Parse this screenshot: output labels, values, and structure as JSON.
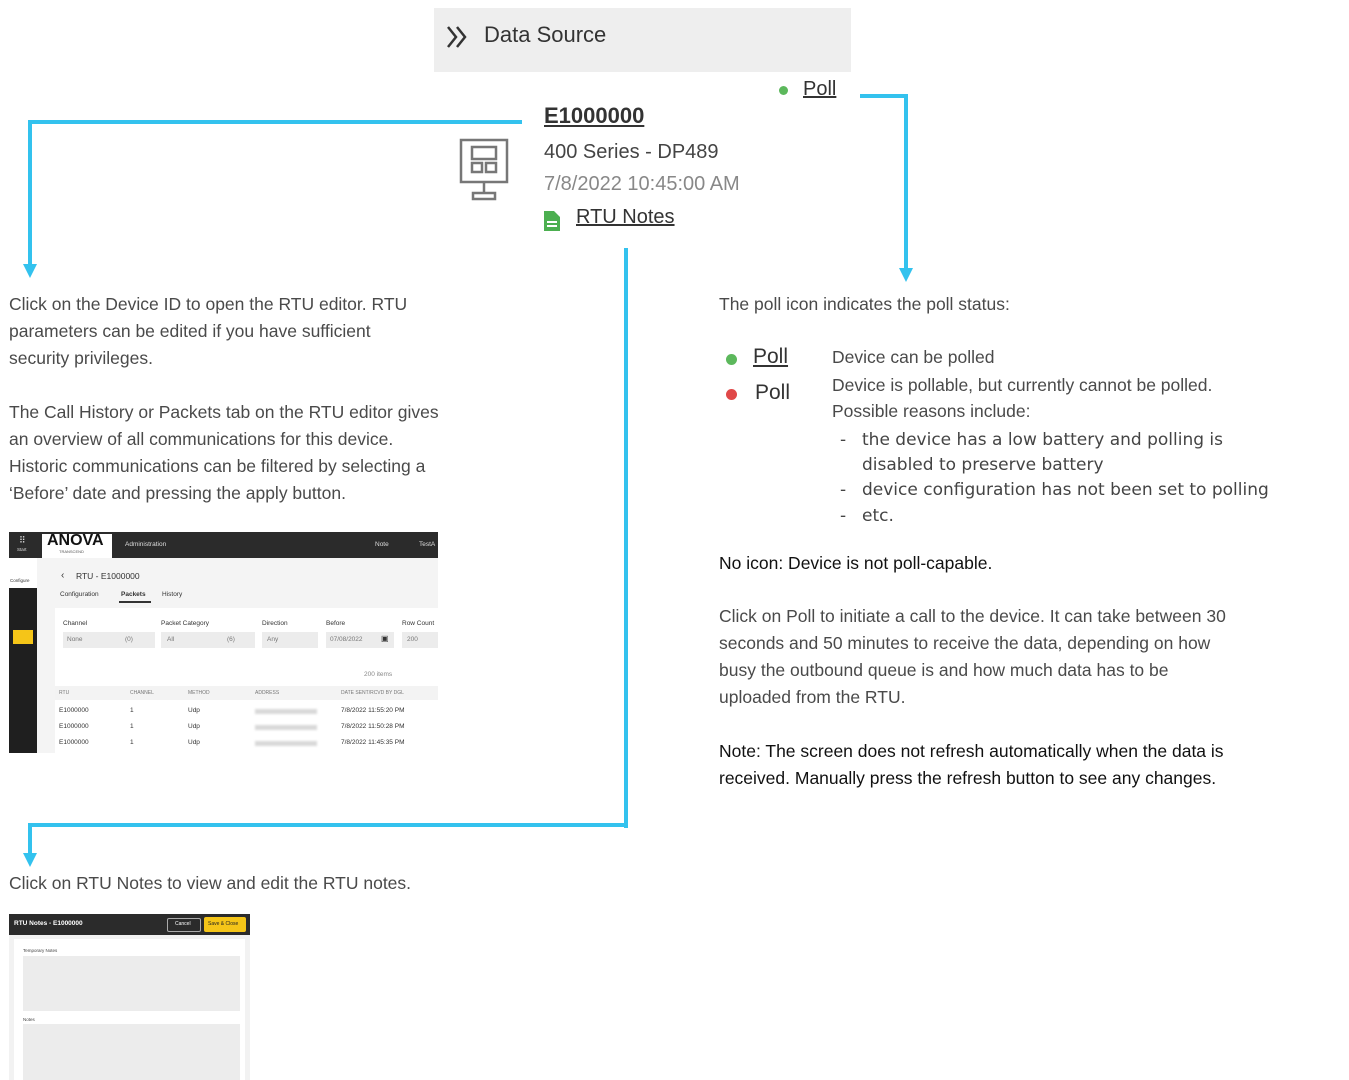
{
  "header": {
    "title": "Data Source",
    "chevron_icon": "double-chevron-right-icon"
  },
  "device": {
    "id": "E1000000",
    "series": "400 Series - DP489",
    "datetime": "7/8/2022 10:45:00 AM",
    "notes_link": "RTU Notes",
    "poll_link": "Poll",
    "poll_color": "#5cb85c"
  },
  "left_text": {
    "p1": [
      "Click on the Device ID to open the RTU editor. RTU",
      "parameters can be edited if you have sufficient",
      "security privileges."
    ],
    "p2": [
      "The Call History or Packets tab on the RTU editor gives",
      "an overview of all communications for this device.",
      "Historic communications can be filtered by selecting a",
      "‘Before’ date and pressing the apply button."
    ],
    "notes_text": "Click on RTU Notes to view and edit the RTU notes."
  },
  "right_text": {
    "intro": "The poll icon indicates the poll status:",
    "legend": [
      {
        "label": "Poll",
        "color": "#5cb85c",
        "desc": "Device can be polled"
      },
      {
        "label": "Poll",
        "color": "#e04848",
        "desc": "Device is pollable, but currently cannot be polled."
      }
    ],
    "reasons_intro": "Possible reasons include:",
    "reasons": [
      "the device has a low battery and polling is",
      "disabled to preserve battery",
      "device configuration has not been set to polling",
      "etc."
    ],
    "no_icon": "No icon: Device is not poll-capable.",
    "click_poll": [
      "Click on Poll to initiate a call to the device. It can take between 30",
      "seconds and 50 minutes to receive the data, depending on how",
      "busy the outbound queue is and how much data has to be",
      "uploaded from the RTU."
    ],
    "note": [
      "Note: The screen does not refresh automatically when the data is",
      "received. Manually press the refresh button to see any changes."
    ]
  },
  "rtu_editor": {
    "brand": "ANOVA",
    "brand_sub": "TRANSCEND",
    "nav": "Administration",
    "start": "Start",
    "configure": "Configure",
    "note": "Note",
    "user": "TestA",
    "title": "RTU - E1000000",
    "tabs": [
      "Configuration",
      "Packets",
      "History"
    ],
    "active_tab": "Packets",
    "filters": [
      {
        "label": "Channel",
        "value": "None",
        "count": "(0)"
      },
      {
        "label": "Packet Category",
        "value": "All",
        "count": "(6)"
      },
      {
        "label": "Direction",
        "value": "Any",
        "count": ""
      },
      {
        "label": "Before",
        "value": "07/08/2022",
        "count": ""
      },
      {
        "label": "Row Count",
        "value": "200",
        "count": ""
      }
    ],
    "items_count": "200 items",
    "columns": [
      "RTU",
      "CHANNEL",
      "METHOD",
      "ADDRESS",
      "DATE SENT/RCVD BY DGL"
    ],
    "rows": [
      [
        "E1000000",
        "1",
        "Udp",
        "7/8/2022 11:55:20 PM"
      ],
      [
        "E1000000",
        "1",
        "Udp",
        "7/8/2022 11:50:28 PM"
      ],
      [
        "E1000000",
        "1",
        "Udp",
        "7/8/2022 11:45:35 PM"
      ]
    ]
  },
  "rtu_notes_dialog": {
    "title": "RTU Notes - E1000000",
    "cancel": "Cancel",
    "save": "Save & Close",
    "temporary_label": "Temporary Notes",
    "notes_label": "Notes"
  }
}
